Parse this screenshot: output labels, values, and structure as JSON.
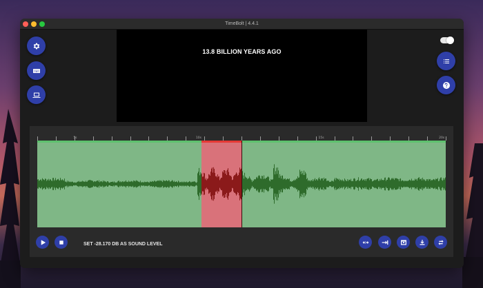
{
  "window": {
    "title": "TimeBolt | 4.4.1"
  },
  "video": {
    "caption": "13.8 BILLION YEARS AGO"
  },
  "left_buttons": [
    {
      "name": "settings-button",
      "icon": "gear-icon"
    },
    {
      "name": "keyboard-button",
      "icon": "keyboard-icon"
    },
    {
      "name": "display-button",
      "icon": "laptop-icon"
    }
  ],
  "right_buttons": [
    {
      "name": "list-button",
      "icon": "list-icon"
    },
    {
      "name": "help-button",
      "icon": "help-icon"
    }
  ],
  "timeline": {
    "tick_labels": [
      "5s",
      "10s",
      "15s",
      "20s"
    ],
    "selection_color": "#d9727a",
    "track_color": "#7fb786",
    "wave_color": "#2e6b2b",
    "wave_cut_color": "#8b1a1a"
  },
  "status": {
    "text": "SET -28.170 DB AS SOUND LEVEL"
  },
  "transport": [
    {
      "name": "play-button",
      "icon": "play-icon"
    },
    {
      "name": "stop-button",
      "icon": "stop-icon"
    }
  ],
  "tools": [
    {
      "name": "expand-button",
      "icon": "expand-horizontal-icon"
    },
    {
      "name": "skip-to-end-button",
      "icon": "skip-to-end-icon"
    },
    {
      "name": "preview-button",
      "icon": "window-icon"
    },
    {
      "name": "download-button",
      "icon": "download-icon"
    },
    {
      "name": "swap-button",
      "icon": "swap-icon"
    }
  ],
  "colors": {
    "accent": "#2f3fa8"
  }
}
